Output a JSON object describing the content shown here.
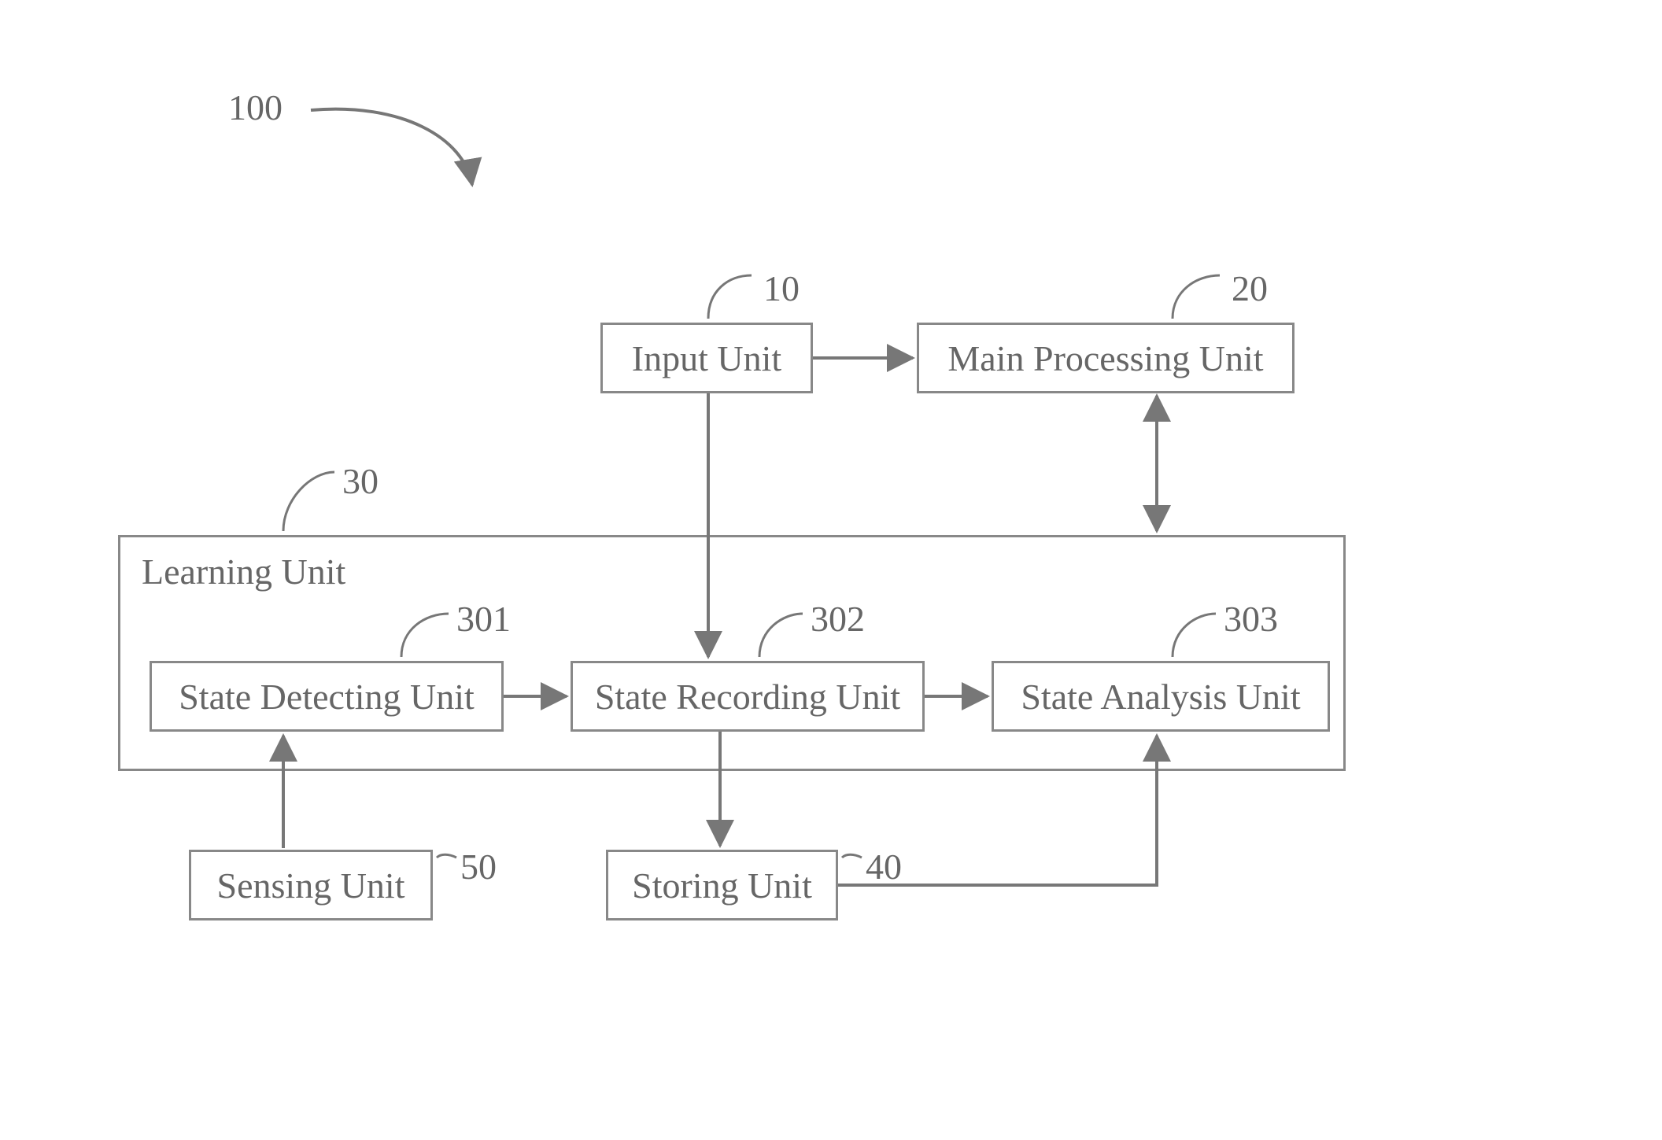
{
  "diagram": {
    "system_ref": "100",
    "blocks": {
      "input": {
        "ref": "10",
        "label": "Input Unit"
      },
      "main": {
        "ref": "20",
        "label": "Main Processing Unit"
      },
      "learning": {
        "ref": "30",
        "label": "Learning Unit"
      },
      "detect": {
        "ref": "301",
        "label": "State Detecting Unit"
      },
      "record": {
        "ref": "302",
        "label": "State Recording Unit"
      },
      "analysis": {
        "ref": "303",
        "label": "State Analysis Unit"
      },
      "storing": {
        "ref": "40",
        "label": "Storing Unit"
      },
      "sensing": {
        "ref": "50",
        "label": "Sensing Unit"
      }
    }
  },
  "chart_data": {
    "type": "block-diagram",
    "title": "",
    "nodes": [
      {
        "id": "100",
        "label": "",
        "kind": "system"
      },
      {
        "id": "10",
        "label": "Input Unit"
      },
      {
        "id": "20",
        "label": "Main Processing Unit"
      },
      {
        "id": "30",
        "label": "Learning Unit",
        "kind": "container",
        "children": [
          "301",
          "302",
          "303"
        ]
      },
      {
        "id": "301",
        "label": "State Detecting Unit"
      },
      {
        "id": "302",
        "label": "State Recording Unit"
      },
      {
        "id": "303",
        "label": "State Analysis Unit"
      },
      {
        "id": "40",
        "label": "Storing Unit"
      },
      {
        "id": "50",
        "label": "Sensing Unit"
      }
    ],
    "edges": [
      {
        "from": "10",
        "to": "20",
        "dir": "uni"
      },
      {
        "from": "10",
        "to": "302",
        "dir": "uni"
      },
      {
        "from": "20",
        "to": "30",
        "dir": "bi",
        "via": "303"
      },
      {
        "from": "50",
        "to": "301",
        "dir": "uni"
      },
      {
        "from": "301",
        "to": "302",
        "dir": "uni"
      },
      {
        "from": "302",
        "to": "303",
        "dir": "uni"
      },
      {
        "from": "302",
        "to": "40",
        "dir": "uni"
      },
      {
        "from": "40",
        "to": "303",
        "dir": "uni"
      }
    ]
  }
}
